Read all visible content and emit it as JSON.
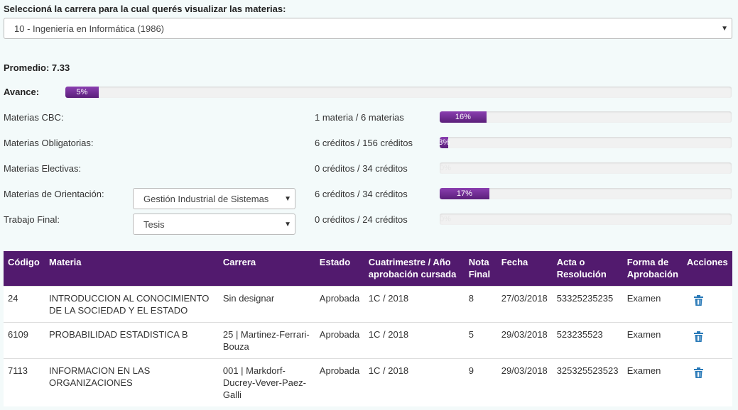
{
  "prompt_label": "Seleccioná la carrera para la cual querés visualizar las materias:",
  "career_select": {
    "value": "10 - Ingeniería en Informática (1986)"
  },
  "promedio": "Promedio: 7.33",
  "avance": {
    "label": "Avance:",
    "percent": 5,
    "text": "5%"
  },
  "progress_rows": [
    {
      "label": "Materias CBC:",
      "credits": "1 materia / 6 materias",
      "percent": 16,
      "text": "16%"
    },
    {
      "label": "Materias Obligatorias:",
      "credits": "6 créditos / 156 créditos",
      "percent": 3,
      "text": "3%"
    },
    {
      "label": "Materias Electivas:",
      "credits": "0 créditos / 34 créditos",
      "percent": 0,
      "text": "0%"
    },
    {
      "label": "Materias de Orientación:",
      "credits": "6 créditos / 34 créditos",
      "percent": 17,
      "text": "17%",
      "select": "Gestión Industrial de Sistemas"
    },
    {
      "label": "Trabajo Final:",
      "credits": "0 créditos / 24 créditos",
      "percent": 0,
      "text": "0%",
      "select": "Tesis"
    }
  ],
  "colors": {
    "accent": "#521a6e",
    "bar_fill": "#6a2a8c",
    "trash": "#2a7ab8"
  },
  "table": {
    "headers": [
      "Código",
      "Materia",
      "Carrera",
      "Estado",
      "Cuatrimestre / Año aprobación cursada",
      "Nota Final",
      "Fecha",
      "Acta o Resolución",
      "Forma de Aprobación",
      "Acciones"
    ],
    "rows": [
      {
        "codigo": "24",
        "materia": "INTRODUCCION AL CONOCIMIENTO DE LA SOCIEDAD Y EL ESTADO",
        "carrera": "Sin designar",
        "estado": "Aprobada",
        "cuatrimestre": "1C / 2018",
        "nota": "8",
        "fecha": "27/03/2018",
        "acta": "53325235235",
        "forma": "Examen"
      },
      {
        "codigo": "6109",
        "materia": "PROBABILIDAD ESTADISTICA B",
        "carrera": "25 | Martinez-Ferrari-Bouza",
        "estado": "Aprobada",
        "cuatrimestre": "1C / 2018",
        "nota": "5",
        "fecha": "29/03/2018",
        "acta": "523235523",
        "forma": "Examen"
      },
      {
        "codigo": "7113",
        "materia": "INFORMACION EN LAS ORGANIZACIONES",
        "carrera": "001 | Markdorf-Ducrey-Vever-Paez-Galli",
        "estado": "Aprobada",
        "cuatrimestre": "1C / 2018",
        "nota": "9",
        "fecha": "29/03/2018",
        "acta": "325325523523",
        "forma": "Examen"
      }
    ]
  }
}
